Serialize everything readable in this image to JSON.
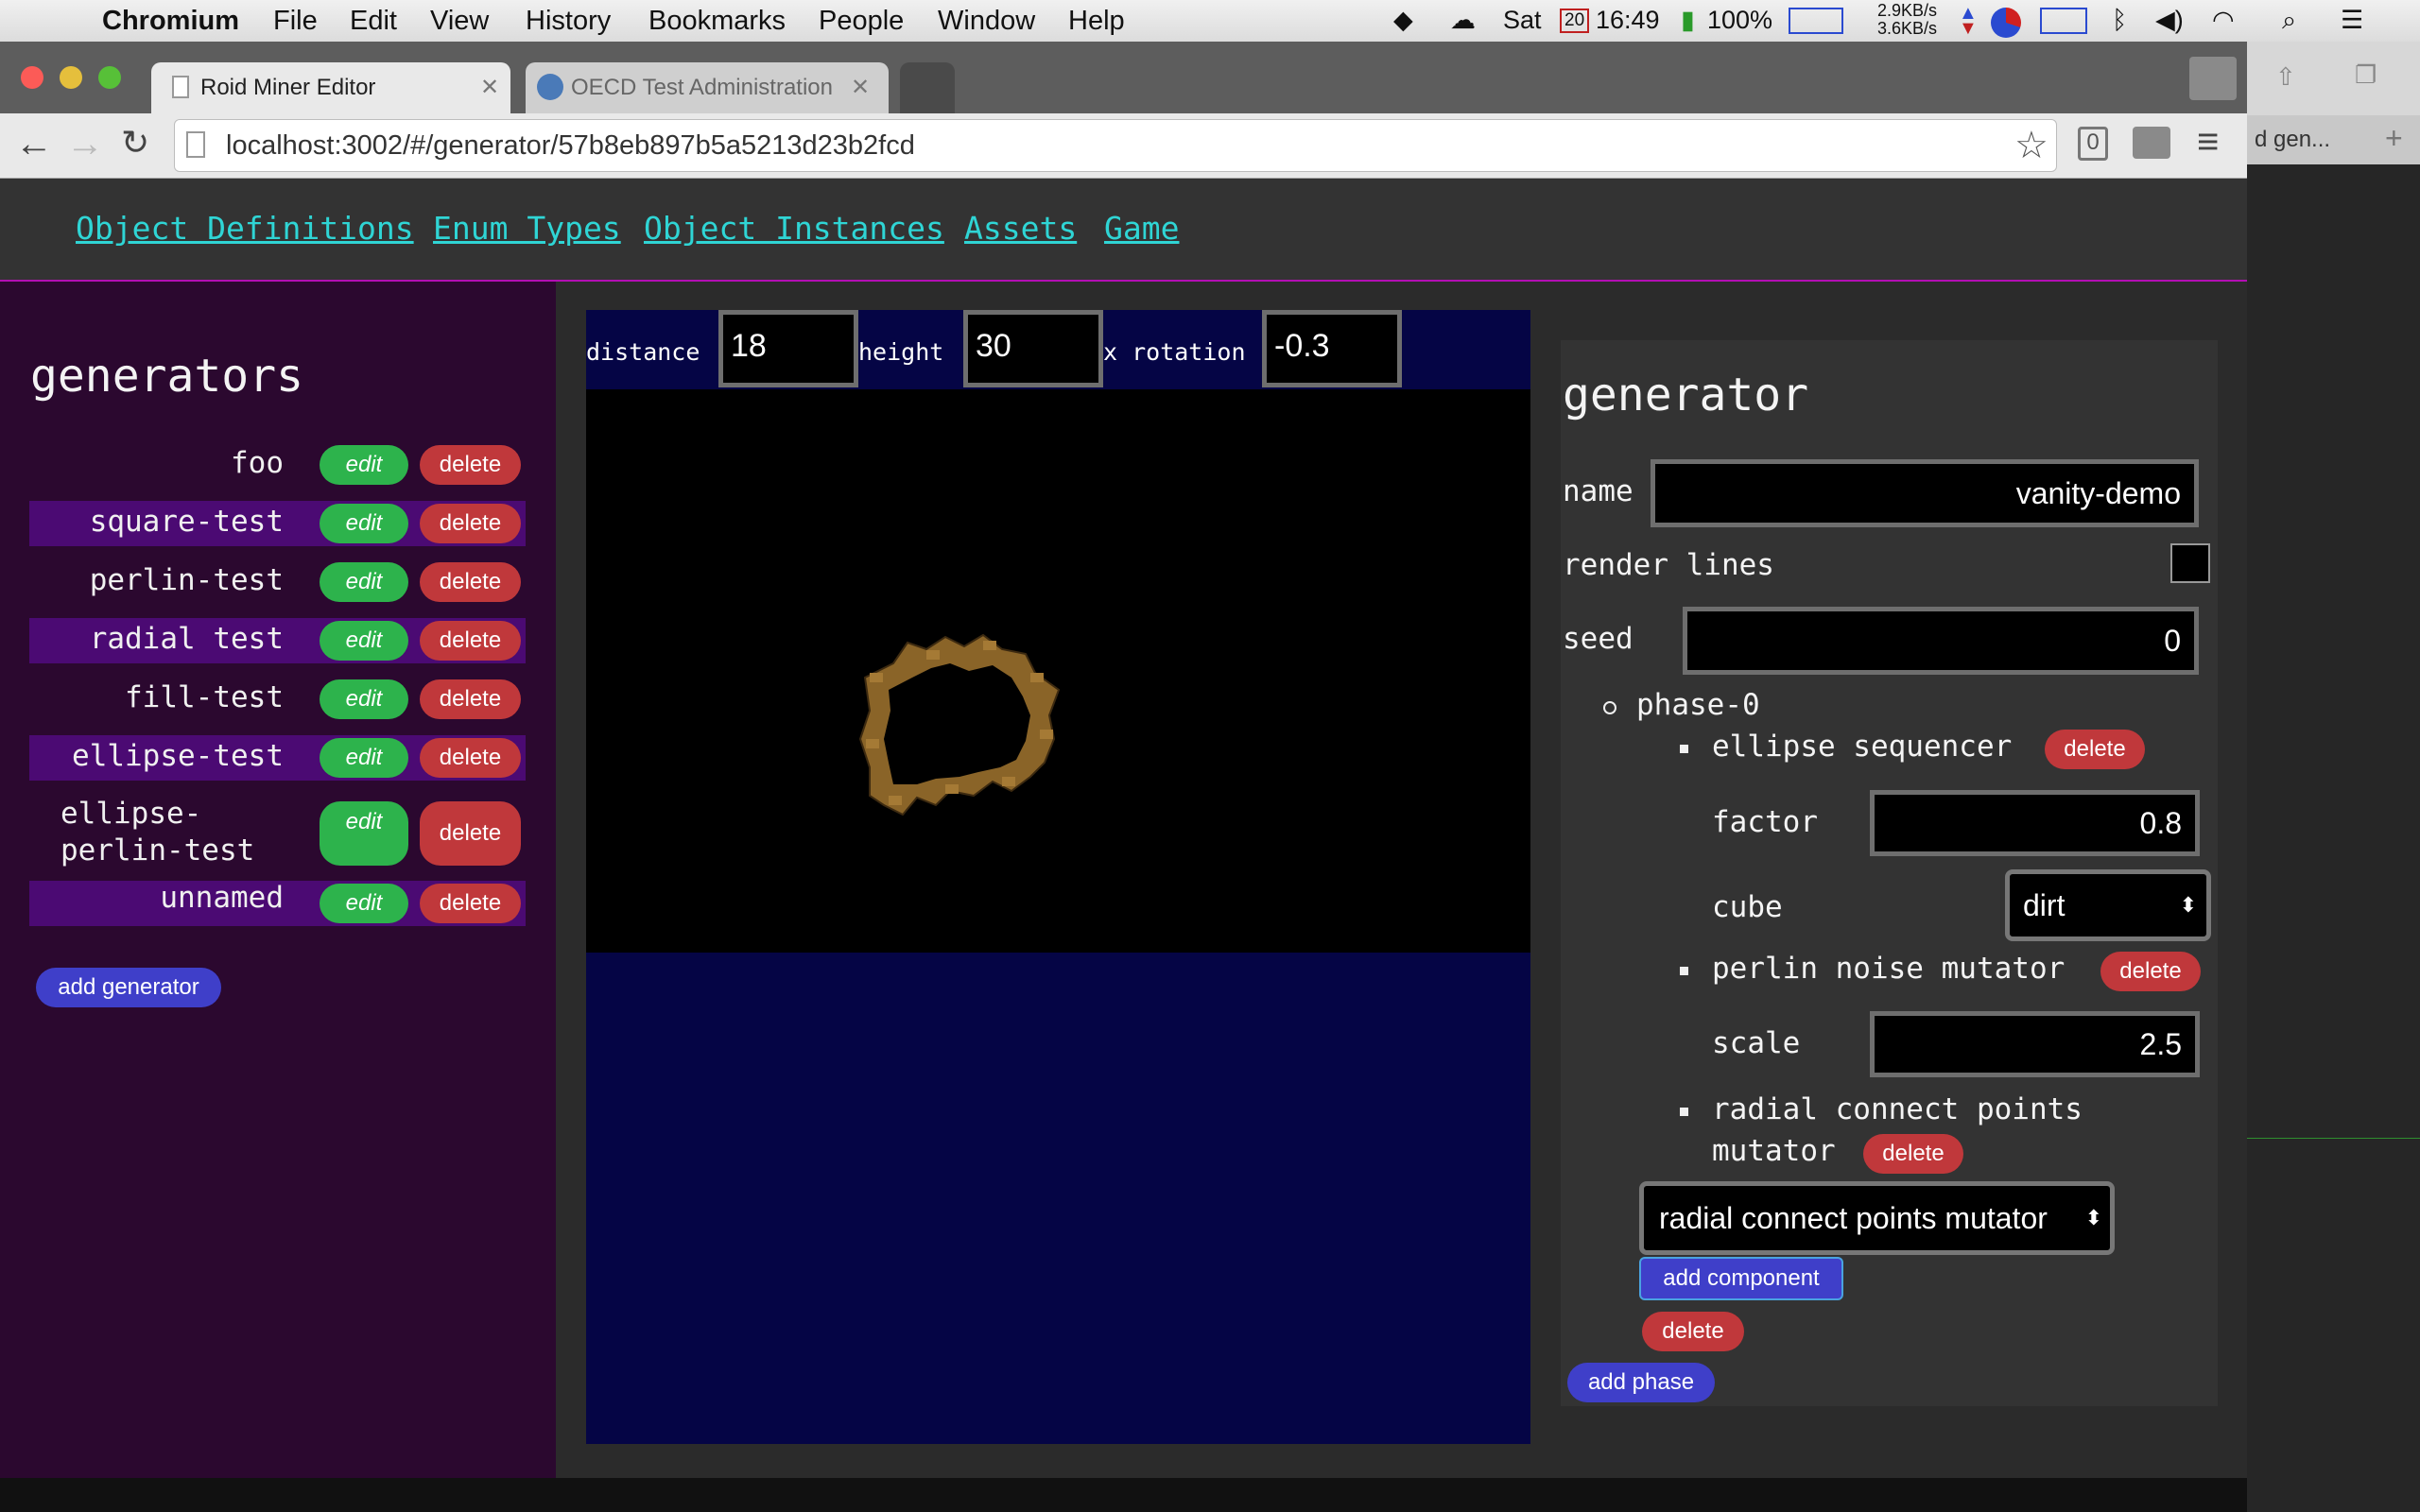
{
  "menubar": {
    "app_name": "Chromium",
    "items": [
      "File",
      "Edit",
      "View",
      "History",
      "Bookmarks",
      "People",
      "Window",
      "Help"
    ],
    "day": "Sat",
    "date_badge": "20",
    "time": "16:49",
    "battery": "100%",
    "net_up": "2.9KB/s",
    "net_down": "3.6KB/s"
  },
  "browser": {
    "tabs": [
      {
        "title": "Roid Miner Editor",
        "active": true
      },
      {
        "title": "OECD Test Administration",
        "active": false
      }
    ],
    "url": "localhost:3002/#/generator/57b8eb897b5a5213d23b2fcd",
    "badge_count": "0",
    "side_window_text": "d gen..."
  },
  "nav": {
    "links": [
      "Object Definitions",
      "Enum Types",
      "Object Instances",
      "Assets",
      "Game"
    ]
  },
  "sidebar": {
    "title": "generators",
    "edit_label": "edit",
    "delete_label": "delete",
    "items": [
      "foo",
      "square-test",
      "perlin-test",
      "radial test",
      "fill-test",
      "ellipse-test",
      "ellipse-perlin-test",
      "unnamed"
    ],
    "add_label": "add generator"
  },
  "viewer": {
    "distance_label": "distance",
    "distance": "18",
    "height_label": "height",
    "height": "30",
    "xrot_label": "x rotation",
    "xrot": "-0.3"
  },
  "panel": {
    "title": "generator",
    "name_label": "name",
    "name_value": "vanity-demo",
    "render_lines_label": "render lines",
    "render_lines_checked": false,
    "seed_label": "seed",
    "seed_value": "0",
    "phase_name": "phase-0",
    "delete_label": "delete",
    "component1": {
      "name": "ellipse sequencer",
      "factor_label": "factor",
      "factor": "0.8",
      "cube_label": "cube",
      "cube": "dirt"
    },
    "component2": {
      "name": "perlin noise mutator",
      "scale_label": "scale",
      "scale": "2.5"
    },
    "component3": {
      "name_line1": "radial connect points",
      "name_line2": "mutator"
    },
    "component_select": "radial connect points mutator",
    "add_component_label": "add component",
    "add_phase_label": "add phase"
  },
  "colors": {
    "nav_link": "#2fd5d5",
    "sidebar_bg": "#2b082f",
    "sidebar_alt_row": "#4b0a73",
    "edit_green": "#2db34c",
    "delete_red": "#c0383b",
    "button_blue": "#3f3fc9",
    "viewport_blue": "#050545"
  }
}
